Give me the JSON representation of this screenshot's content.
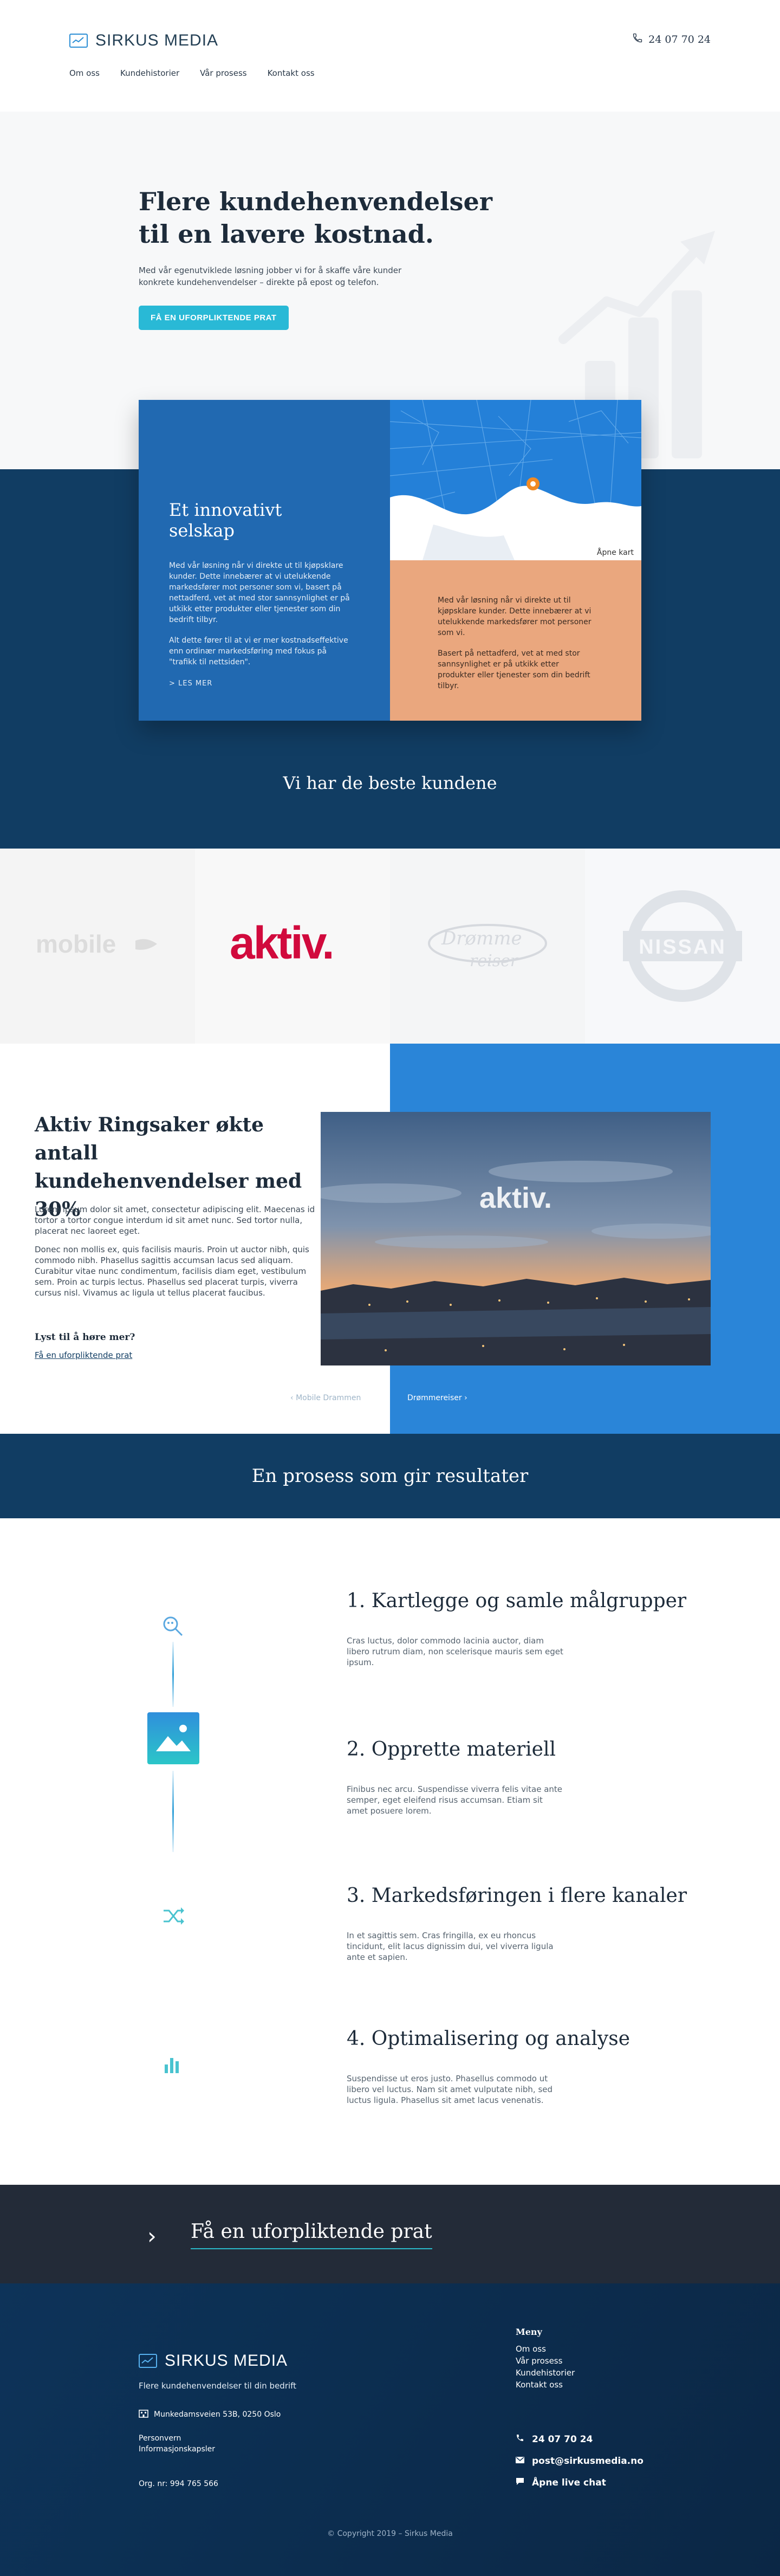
{
  "header": {
    "brand": "SIRKUS MEDIA",
    "phone": "24 07 70 24",
    "nav": [
      "Om oss",
      "Kundehistorier",
      "Vår prosess",
      "Kontakt oss"
    ]
  },
  "hero": {
    "title": "Flere kundehenvendelser til en lavere kostnad.",
    "lead": "Med vår egenutviklede løsning jobber vi for å skaffe våre kunder konkrete kundehenvendelser – direkte på epost og telefon.",
    "cta": "FÅ EN UFORPLIKTENDE PRAT"
  },
  "intro": {
    "title": "Et innovativt selskap",
    "p1": "Med vår løsning når vi direkte ut til kjøpsklare kunder. Dette innebærer at vi utelukkende markedsfører mot personer som vi, basert på nettadferd, vet at med stor sannsynlighet er på utkikk etter produkter eller tjenester som din bedrift tilbyr.",
    "p2": "Alt dette fører til at vi er mer kostnadseffektive enn ordinær markedsføring med fokus på \"trafikk til nettsiden\".",
    "more": "> LES MER",
    "map_button": "Åpne kart",
    "r1": "Med vår løsning når vi direkte ut til kjøpsklare kunder. Dette innebærer at vi utelukkende markedsfører mot personer som vi.",
    "r2": "Basert på nettadferd, vet at med stor sannsynlighet er på utkikk etter produkter eller tjenester som din bedrift tilbyr."
  },
  "customers": {
    "heading": "Vi har de beste kundene",
    "logos": [
      {
        "name": "mobile",
        "color": "#dedede"
      },
      {
        "name": "aktiv.",
        "color": "#d10a3d"
      },
      {
        "name": "Drømme reiser",
        "color": "#d8dbe0"
      },
      {
        "name": "NISSAN",
        "color": "#dfe3e8"
      }
    ]
  },
  "case": {
    "title": "Aktiv Ringsaker økte antall kundehenvendelser med 30%",
    "p1": "Lorem ipsum dolor sit amet, consectetur adipiscing elit. Maecenas id tortor a tortor congue interdum id sit amet nunc. Sed tortor nulla, placerat nec laoreet eget.",
    "p2": "Donec non mollis ex, quis facilisis mauris. Proin ut auctor nibh, quis commodo nibh. Phasellus sagittis accumsan lacus sed aliquam. Curabitur vitae nunc condimentum, facilisis diam eget, vestibulum sem. Proin ac turpis lectus. Phasellus sed placerat turpis, viverra cursus nisl. Vivamus ac ligula ut tellus placerat faucibus.",
    "lyst": "Lyst til å høre mer?",
    "link": "Få en uforpliktende prat",
    "photo_text": "aktiv.",
    "prev": "Mobile Drammen",
    "next": "Drømmereiser"
  },
  "process": {
    "heading": "En prosess som gir resultater",
    "steps": [
      {
        "title": "1. Kartlegge og samle målgrupper",
        "text": "Cras luctus, dolor commodo lacinia auctor, diam libero rutrum diam, non scelerisque mauris sem eget ipsum."
      },
      {
        "title": "2. Opprette materiell",
        "text": "Finibus nec arcu. Suspendisse viverra felis vitae ante semper, eget eleifend risus accumsan. Etiam sit amet posuere lorem."
      },
      {
        "title": "3. Markedsføringen i flere kanaler",
        "text": "In et sagittis sem. Cras fringilla, ex eu rhoncus tincidunt, elit lacus dignissim dui, vel viverra ligula ante et sapien."
      },
      {
        "title": "4. Optimalisering og analyse",
        "text": "Suspendisse ut eros justo. Phasellus commodo ut libero vel luctus. Nam sit amet vulputate nibh, sed luctus ligula. Phasellus sit amet lacus venenatis."
      }
    ]
  },
  "cta_band": {
    "label": "Få en uforpliktende prat"
  },
  "footer": {
    "brand": "SIRKUS MEDIA",
    "tagline": "Flere kundehenvendelser til din bedrift",
    "address": "Munkedamsveien 53B, 0250 Oslo",
    "links": [
      "Personvern",
      "Informasjonskapsler"
    ],
    "org": "Org. nr: 994 765 566",
    "menu_heading": "Meny",
    "menu": [
      "Om oss",
      "Vår prosess",
      "Kundehistorier",
      "Kontakt oss"
    ],
    "phone": "24 07 70 24",
    "email": "post@sirkusmedia.no",
    "chat": "Åpne live chat",
    "copyright": "© Copyright 2019 – Sirkus Media"
  },
  "colors": {
    "primary": "#2169b1",
    "navy": "#113d63",
    "accent": "#29b9d6",
    "salmon": "#eaa77e",
    "dark": "#232b38"
  }
}
